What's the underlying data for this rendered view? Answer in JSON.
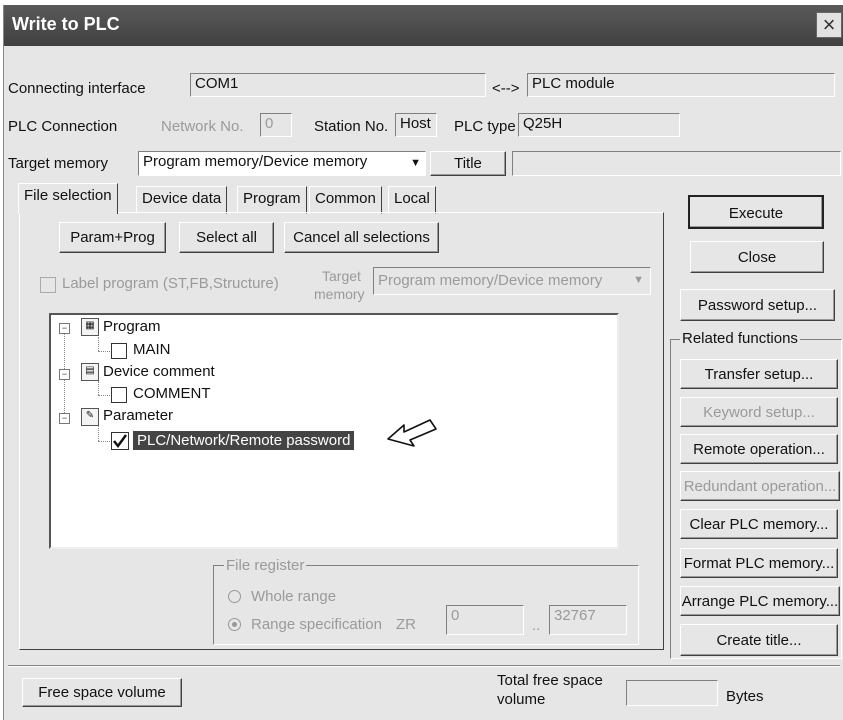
{
  "window": {
    "title": "Write to PLC",
    "close_glyph": "×"
  },
  "connection": {
    "interface_label": "Connecting interface",
    "interface_value": "COM1",
    "arrow": "<-->",
    "target_value": "PLC module",
    "plc_connection_label": "PLC Connection",
    "network_no_label": "Network No.",
    "network_no_value": "0",
    "station_no_label": "Station No.",
    "station_no_value": "Host",
    "plc_type_label": "PLC type",
    "plc_type_value": "Q25H"
  },
  "target_memory": {
    "label": "Target memory",
    "value": "Program memory/Device memory",
    "title_button": "Title",
    "title_value": ""
  },
  "tabs": [
    "File selection",
    "Device data",
    "Program",
    "Common",
    "Local"
  ],
  "file_selection": {
    "param_prog": "Param+Prog",
    "select_all": "Select all",
    "cancel_all": "Cancel all selections",
    "label_program": "Label program (ST,FB,Structure)",
    "target_label_1": "Target",
    "target_label_2": "memory",
    "target_memory_value": "Program memory/Device memory"
  },
  "tree": {
    "program": "Program",
    "main": "MAIN",
    "device_comment": "Device comment",
    "comment": "COMMENT",
    "parameter": "Parameter",
    "password": "PLC/Network/Remote password"
  },
  "file_register": {
    "title": "File register",
    "whole_range": "Whole range",
    "range_spec": "Range specification",
    "zr_label": "ZR",
    "start": "0",
    "sep": "..",
    "end": "32767"
  },
  "side_buttons": {
    "execute": "Execute",
    "close": "Close",
    "password_setup": "Password setup...",
    "related_functions": "Related functions",
    "transfer_setup": "Transfer setup...",
    "keyword_setup": "Keyword setup...",
    "remote_operation": "Remote operation...",
    "redundant_operation": "Redundant operation...",
    "clear_memory": "Clear PLC memory...",
    "format_memory": "Format PLC memory...",
    "arrange_memory": "Arrange PLC memory...",
    "create_title": "Create title..."
  },
  "footer": {
    "free_space_button": "Free space volume",
    "total_free_1": "Total free space",
    "total_free_2": "volume",
    "total_free_value": "",
    "bytes": "Bytes"
  }
}
